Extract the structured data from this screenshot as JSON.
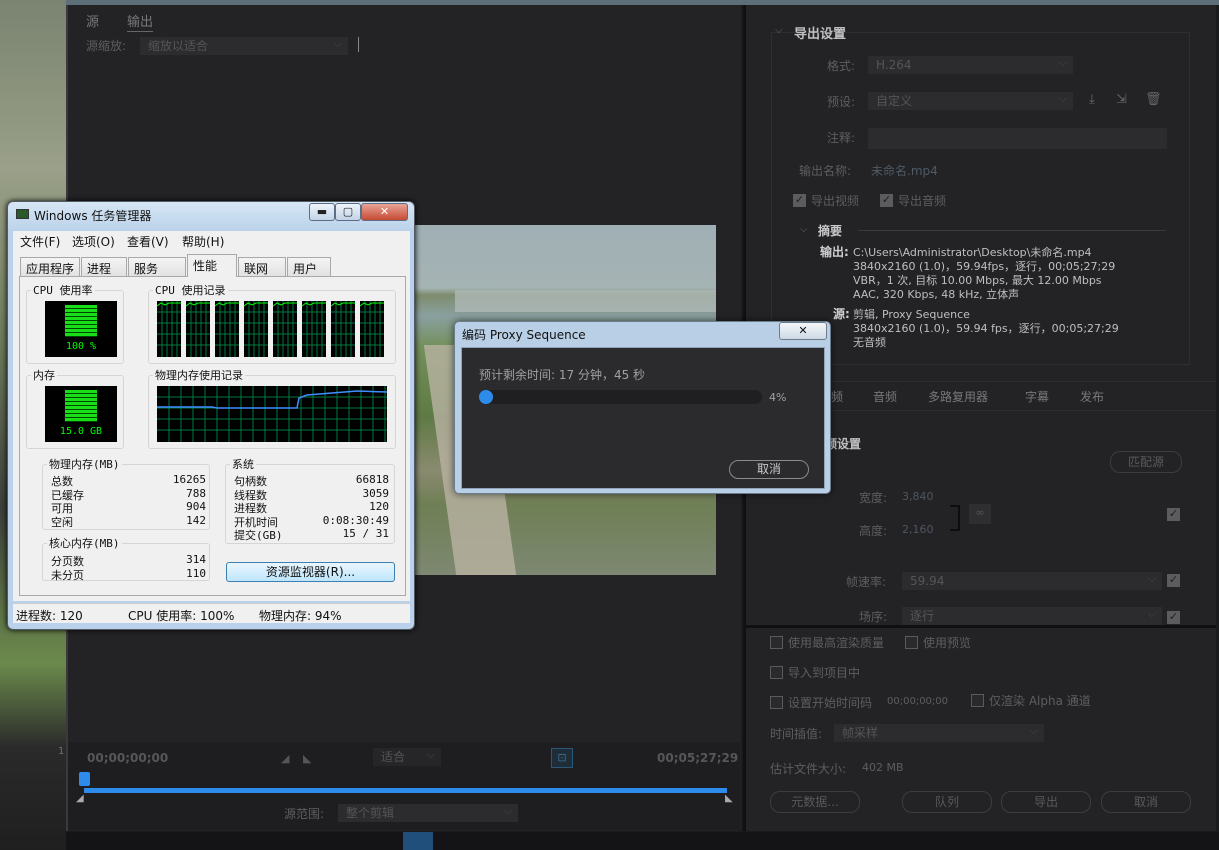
{
  "source_panel": {
    "tab_source": "源",
    "tab_output": "输出",
    "scale_label": "源缩放:",
    "scale_value": "缩放以适合",
    "timecode_start": "00;00;00;00",
    "fit_value": "适合",
    "timecode_end": "00;05;27;29",
    "range_label": "源范围:",
    "range_value": "整个剪辑",
    "left_marker": "1"
  },
  "export_settings": {
    "section_title": "导出设置",
    "format_label": "格式:",
    "format_value": "H.264",
    "preset_label": "预设:",
    "preset_value": "自定义",
    "comment_label": "注释:",
    "output_name_label": "输出名称:",
    "output_name_value": "未命名.mp4",
    "export_video": "导出视频",
    "export_audio": "导出音频",
    "summary_title": "摘要",
    "output_label": "输出:",
    "output_line1": "C:\\Users\\Administrator\\Desktop\\未命名.mp4",
    "output_line2": "3840x2160 (1.0)，59.94fps，逐行，00;05;27;29",
    "output_line3": "VBR，1 次, 目标 10.00 Mbps, 最大 12.00 Mbps",
    "output_line4": "AAC, 320 Kbps, 48  kHz, 立体声",
    "source_label": "源:",
    "source_line1": "剪辑, Proxy Sequence",
    "source_line2": "3840x2160 (1.0)，59.94 fps，逐行，00;05;27;29",
    "source_line3": "无音频",
    "tabs": [
      "频",
      "音频",
      "多路复用器",
      "字幕",
      "发布"
    ],
    "video_settings_title": "频设置",
    "match_source": "匹配源",
    "width_label": "宽度:",
    "width_value": "3,840",
    "height_label": "高度:",
    "height_value": "2,160",
    "framerate_label": "帧速率:",
    "framerate_value": "59.94",
    "field_order_label": "场序:",
    "field_order_value": "逐行",
    "max_render_quality": "使用最高渲染质量",
    "use_previews": "使用预览",
    "import_to_project": "导入到项目中",
    "set_start_timecode": "设置开始时间码",
    "start_timecode_value": "00;00;00;00",
    "render_alpha": "仅渲染 Alpha 通道",
    "time_interp_label": "时间插值:",
    "time_interp_value": "帧采样",
    "est_size_label": "估计文件大小:",
    "est_size_value": "402 MB",
    "btn_metadata": "元数据...",
    "btn_queue": "队列",
    "btn_export": "导出",
    "btn_cancel": "取消"
  },
  "task_manager": {
    "title": "Windows 任务管理器",
    "menu": [
      "文件(F)",
      "选项(O)",
      "查看(V)",
      "帮助(H)"
    ],
    "tabs": [
      "应用程序",
      "进程",
      "服务",
      "性能",
      "联网",
      "用户"
    ],
    "cpu_usage_label": "CPU 使用率",
    "cpu_usage_value": "100 %",
    "cpu_history_label": "CPU 使用记录",
    "memory_label": "内存",
    "memory_value": "15.0 GB",
    "mem_history_label": "物理内存使用记录",
    "phys_mem_title": "物理内存(MB)",
    "phys_mem_rows": [
      {
        "k": "总数",
        "v": "16265"
      },
      {
        "k": "已缓存",
        "v": "788"
      },
      {
        "k": "可用",
        "v": "904"
      },
      {
        "k": "空闲",
        "v": "142"
      }
    ],
    "system_title": "系统",
    "system_rows": [
      {
        "k": "句柄数",
        "v": "66818"
      },
      {
        "k": "线程数",
        "v": "3059"
      },
      {
        "k": "进程数",
        "v": "120"
      },
      {
        "k": "开机时间",
        "v": "0:08:30:49"
      },
      {
        "k": "提交(GB)",
        "v": "15 / 31"
      }
    ],
    "kernel_mem_title": "核心内存(MB)",
    "kernel_rows": [
      {
        "k": "分页数",
        "v": "314"
      },
      {
        "k": "未分页",
        "v": "110"
      }
    ],
    "resource_monitor_btn": "资源监视器(R)...",
    "status_processes": "进程数: 120",
    "status_cpu": "CPU 使用率: 100%",
    "status_memory": "物理内存: 94%",
    "cpu_level": 1.0,
    "memory_level": 0.94
  },
  "encode_dialog": {
    "title": "编码 Proxy Sequence",
    "remaining": "预计剩余时间: 17 分钟，45 秒",
    "progress_text": "4%",
    "progress": 0.04,
    "cancel": "取消"
  },
  "colors": {
    "accent_blue": "#2d8ceb",
    "monitor_green": "#00ff00",
    "panel_bg": "#232325"
  }
}
